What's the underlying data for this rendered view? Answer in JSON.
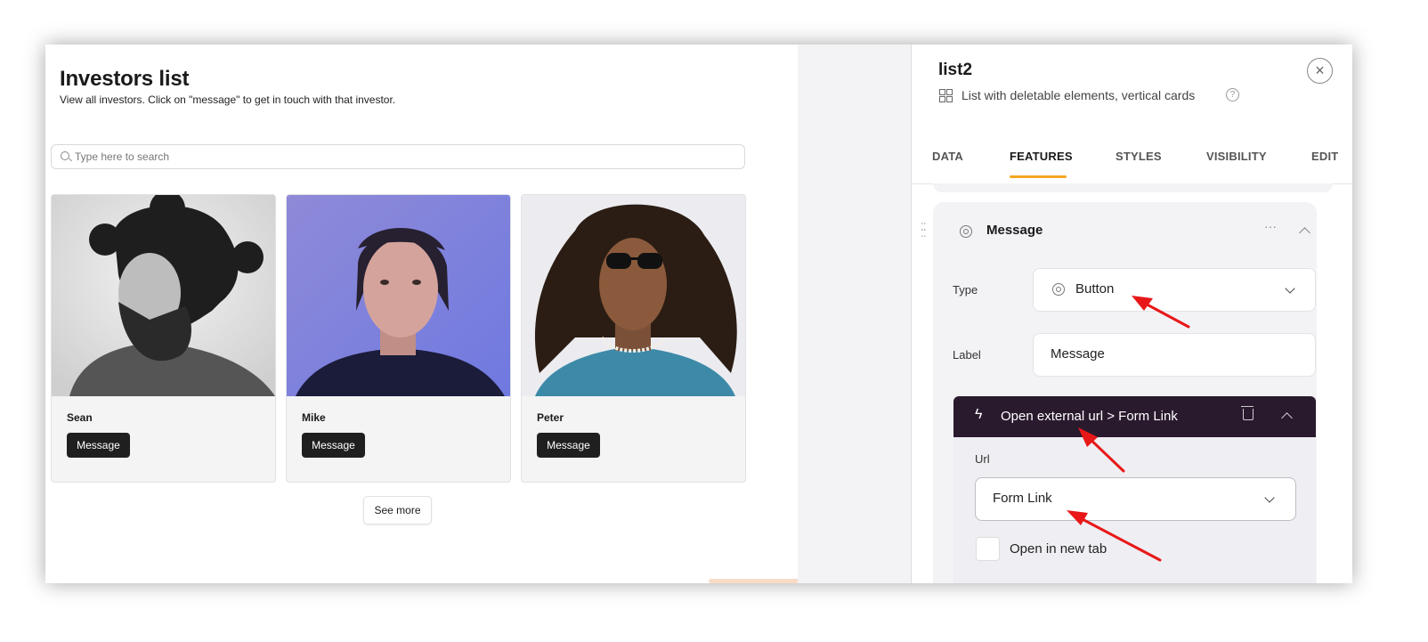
{
  "canvas": {
    "title": "Investors list",
    "subtitle": "View all investors. Click on \"message\" to get in touch with that investor.",
    "search_placeholder": "Type here to search",
    "cards": [
      {
        "name": "Sean",
        "button": "Message"
      },
      {
        "name": "Mike",
        "button": "Message"
      },
      {
        "name": "Peter",
        "button": "Message"
      }
    ],
    "see_more": "See more"
  },
  "panel": {
    "title": "list2",
    "subtitle": "List with deletable elements, vertical cards",
    "help": "?",
    "close": "×",
    "tabs": [
      "DATA",
      "FEATURES",
      "STYLES",
      "VISIBILITY",
      "EDIT"
    ],
    "active_tab": "FEATURES",
    "section": {
      "title": "Message",
      "dots": "···",
      "type_label": "Type",
      "type_value": "Button",
      "label_label": "Label",
      "label_value": "Message",
      "action": {
        "bolt": "ϟ",
        "title": "Open external url > Form Link",
        "url_label": "Url",
        "url_value": "Form Link",
        "checkbox_label": "Open in new tab",
        "checkbox_checked": false
      }
    }
  },
  "colors": {
    "accent": "#f5a623",
    "action_header": "#2a1a2e",
    "button_dark": "#1f1f1f",
    "annotation_arrow": "#e81818"
  },
  "icons": [
    "search-icon",
    "grid-icon",
    "help-icon",
    "close-icon",
    "drag-handle-icon",
    "button-type-icon",
    "more-icon",
    "chevron-up-icon",
    "chevron-down-icon",
    "bolt-icon",
    "trash-icon"
  ]
}
